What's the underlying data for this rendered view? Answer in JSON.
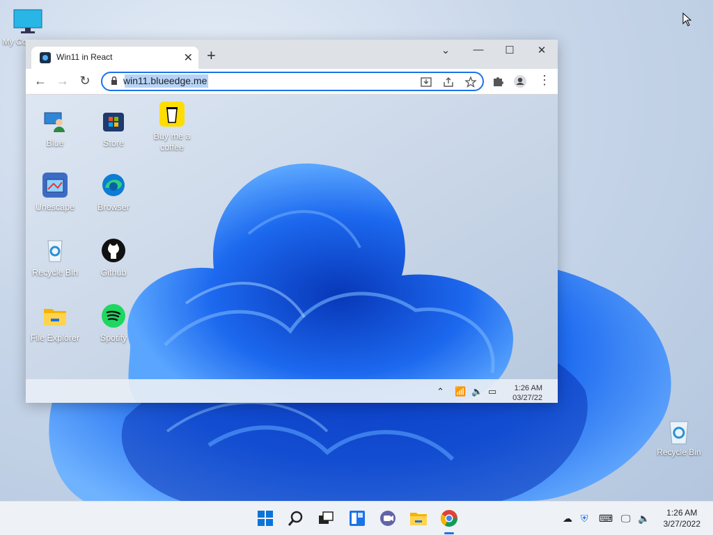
{
  "desktop": {
    "icons": [
      {
        "label": "My Co",
        "icon": "monitor-icon"
      },
      {
        "label": "Recycle Bin",
        "icon": "recycle-bin-icon"
      }
    ]
  },
  "browser": {
    "tab_title": "Win11 in React",
    "url": "win11.blueedge.me",
    "tab_close": "✕",
    "new_tab": "+"
  },
  "inner_desktop": {
    "icons": [
      {
        "label": "Blue",
        "icon": "blue-user-icon"
      },
      {
        "label": "Store",
        "icon": "store-icon"
      },
      {
        "label": "Buy me a coffee",
        "icon": "coffee-icon"
      },
      {
        "label": "Unescape",
        "icon": "unescape-icon"
      },
      {
        "label": "Browser",
        "icon": "edge-icon"
      },
      {
        "label": "Recycle Bin",
        "icon": "recycle-bin-icon"
      },
      {
        "label": "Github",
        "icon": "github-icon"
      },
      {
        "label": "File Explorer",
        "icon": "folder-icon"
      },
      {
        "label": "Spotify",
        "icon": "spotify-icon"
      }
    ],
    "taskbar": {
      "time": "1:26 AM",
      "date": "03/27/22"
    }
  },
  "taskbar": {
    "time": "1:26 AM",
    "date": "3/27/2022",
    "apps": [
      "start-icon",
      "search-icon",
      "task-view-icon",
      "widgets-icon",
      "teams-chat-icon",
      "file-explorer-icon",
      "chrome-icon"
    ]
  },
  "colors": {
    "accent": "#1a73e8",
    "wallpaper_blue": "#1a5fe0"
  }
}
